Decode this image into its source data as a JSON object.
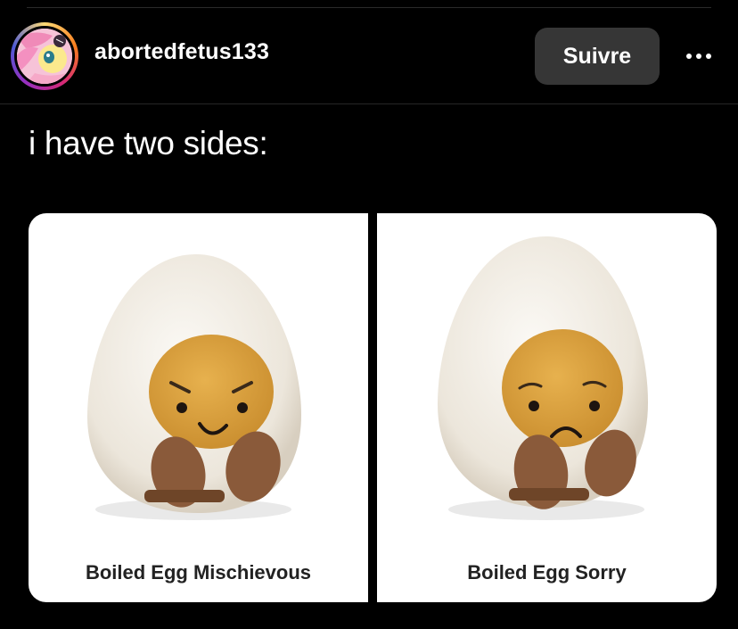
{
  "post": {
    "username": "abortedfetus133",
    "follow_label": "Suivre",
    "caption": "i have two sides:"
  },
  "image": {
    "panels": [
      {
        "label": "Boiled Egg Mischievous",
        "expression": "mischievous"
      },
      {
        "label": "Boiled Egg Sorry",
        "expression": "sorry"
      }
    ]
  },
  "colors": {
    "background": "#000000",
    "follow_button": "#363636",
    "yolk": "#e0a53f",
    "egg_white": "#f3efe8",
    "feet": "#8a5a3a"
  },
  "icons": {
    "more": "more-horizontal-icon",
    "avatar": "avatar-image"
  }
}
